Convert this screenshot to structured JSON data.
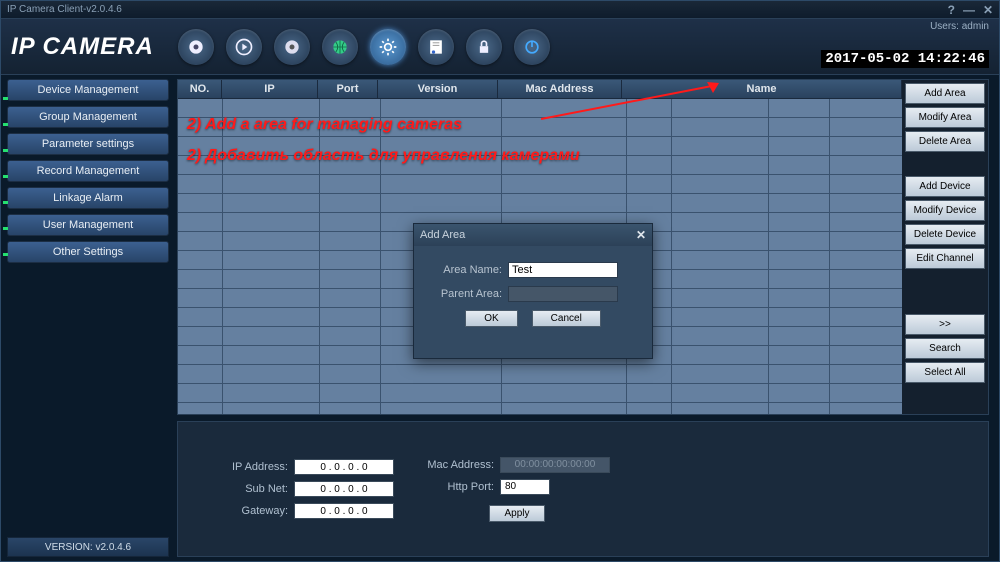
{
  "window": {
    "title": "IP Camera Client-v2.0.4.6",
    "logo": "IP CAMERA",
    "users_label": "Users:",
    "user": "admin",
    "timestamp": "2017-05-02 14:22:46"
  },
  "toolbar_icons": [
    "eye",
    "play",
    "record",
    "globe",
    "settings",
    "log",
    "lock",
    "power"
  ],
  "sidebar": {
    "items": [
      "Device Management",
      "Group Management",
      "Parameter settings",
      "Record Management",
      "Linkage Alarm",
      "User Management",
      "Other Settings"
    ],
    "version": "VERSION: v2.0.4.6"
  },
  "table": {
    "headers": {
      "no": "NO.",
      "ip": "IP",
      "port": "Port",
      "version": "Version",
      "mac": "Mac Address",
      "name": "Name"
    }
  },
  "side_buttons": {
    "add_area": "Add Area",
    "modify_area": "Modify Area",
    "delete_area": "Delete Area",
    "add_device": "Add Device",
    "modify_device": "Modify Device",
    "delete_device": "Delete Device",
    "edit_channel": "Edit Channel",
    "expand": ">>",
    "search": "Search",
    "select_all": "Select All"
  },
  "bottom": {
    "ip_label": "IP Address:",
    "ip": "0 . 0 . 0 . 0",
    "subnet_label": "Sub Net:",
    "subnet": "0 . 0 . 0 . 0",
    "gateway_label": "Gateway:",
    "gateway": "0 . 0 . 0 . 0",
    "mac_label": "Mac Address:",
    "mac": "00:00:00:00:00:00",
    "httpport_label": "Http Port:",
    "httpport": "80",
    "apply": "Apply"
  },
  "dialog": {
    "title": "Add Area",
    "area_name_label": "Area Name:",
    "area_name": "Test",
    "parent_label": "Parent Area:",
    "parent": "",
    "ok": "OK",
    "cancel": "Cancel"
  },
  "annotations": {
    "en": "2) Add a area for managing cameras",
    "ru": "2) Добавить область для управления камерами"
  }
}
